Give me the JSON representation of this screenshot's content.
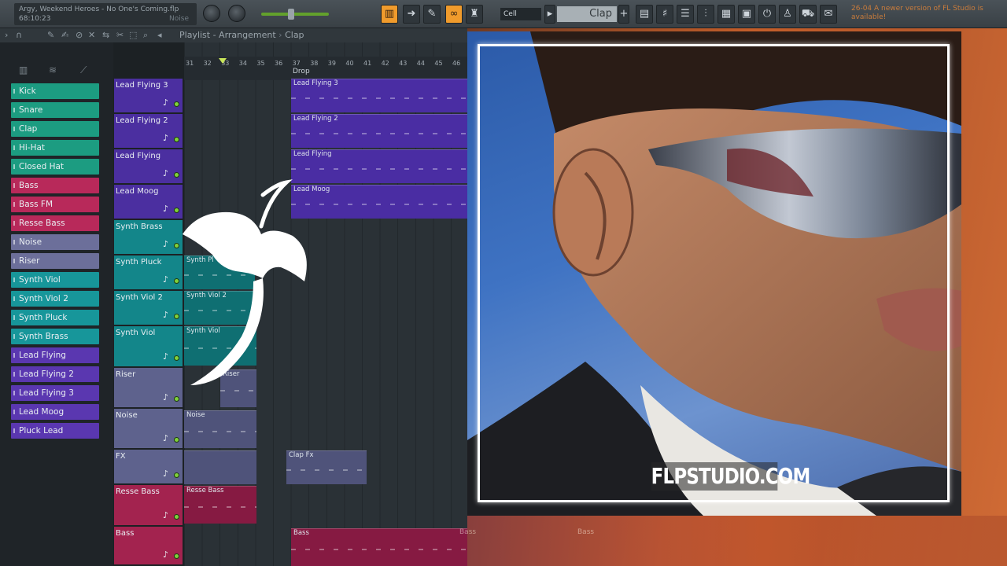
{
  "window": {
    "song_title": "Argy, Weekend Heroes - No One's Coming.flp",
    "time": "68:10:23",
    "noise_label": "Noise"
  },
  "toolbar": {
    "snap": "Cell",
    "pattern": "Clap",
    "hint": "26-04  A newer version of FL Studio is available!",
    "accent_color": "#f09b2c"
  },
  "playlist": {
    "breadcrumb": "Playlist - Arrangement",
    "breadcrumb_clip": "Clap",
    "marker": "Drop",
    "ruler_ticks": [
      "31",
      "32",
      "33",
      "34",
      "35",
      "36",
      "37",
      "38",
      "39",
      "40",
      "41",
      "42",
      "43",
      "44",
      "45",
      "46"
    ]
  },
  "channels": [
    {
      "name": "Kick",
      "color": "#1c9c81"
    },
    {
      "name": "Snare",
      "color": "#1c9c81"
    },
    {
      "name": "Clap",
      "color": "#1c9c81"
    },
    {
      "name": "Hi-Hat",
      "color": "#1c9c81"
    },
    {
      "name": "Closed Hat",
      "color": "#1c9c81"
    },
    {
      "name": "Bass",
      "color": "#b8295a"
    },
    {
      "name": "Bass FM",
      "color": "#b8295a"
    },
    {
      "name": "Resse Bass",
      "color": "#b8295a"
    },
    {
      "name": "Noise",
      "color": "#6c6f9a"
    },
    {
      "name": "Riser",
      "color": "#6c6f9a"
    },
    {
      "name": "Synth Viol",
      "color": "#17969a"
    },
    {
      "name": "Synth Viol 2",
      "color": "#17969a"
    },
    {
      "name": "Synth Pluck",
      "color": "#17969a"
    },
    {
      "name": "Synth Brass",
      "color": "#17969a"
    },
    {
      "name": "Lead Flying",
      "color": "#5a37b0"
    },
    {
      "name": "Lead Flying 2",
      "color": "#5a37b0"
    },
    {
      "name": "Lead Flying 3",
      "color": "#5a37b0"
    },
    {
      "name": "Lead Moog",
      "color": "#5a37b0"
    },
    {
      "name": "Pluck Lead",
      "color": "#5a37b0"
    }
  ],
  "tracks": [
    {
      "name": "Lead Flying 3",
      "color": "#4b2fa0"
    },
    {
      "name": "Lead Flying 2",
      "color": "#4b2fa0"
    },
    {
      "name": "Lead Flying",
      "color": "#4b2fa0"
    },
    {
      "name": "Lead Moog",
      "color": "#4b2fa0"
    },
    {
      "name": "Synth Brass",
      "color": "#13868a"
    },
    {
      "name": "Synth Pluck",
      "color": "#13868a"
    },
    {
      "name": "Synth Viol 2",
      "color": "#13868a"
    },
    {
      "name": "Synth Viol",
      "color": "#13868a"
    },
    {
      "name": "Riser",
      "color": "#5e628d"
    },
    {
      "name": "Noise",
      "color": "#5e628d"
    },
    {
      "name": "FX",
      "color": "#5e628d"
    },
    {
      "name": "Resse Bass",
      "color": "#a3234f"
    },
    {
      "name": "Bass",
      "color": "#a3234f"
    }
  ],
  "clips": [
    {
      "label": "Lead Flying 3"
    },
    {
      "label": "Lead Flying 2"
    },
    {
      "label": "Lead Flying"
    },
    {
      "label": "Lead Moog"
    },
    {
      "label": "Synth Pl"
    },
    {
      "label": "Synth Viol 2"
    },
    {
      "label": "Synth Viol"
    },
    {
      "label": "Riser"
    },
    {
      "label": "Noise"
    },
    {
      "label": "Clap Fx"
    },
    {
      "label": "Resse Bass"
    },
    {
      "label": "Bass"
    }
  ],
  "bottom_clips": [
    "Bass",
    "Bass"
  ],
  "album": {
    "watermark": "FLPSTUDIO.COM"
  }
}
